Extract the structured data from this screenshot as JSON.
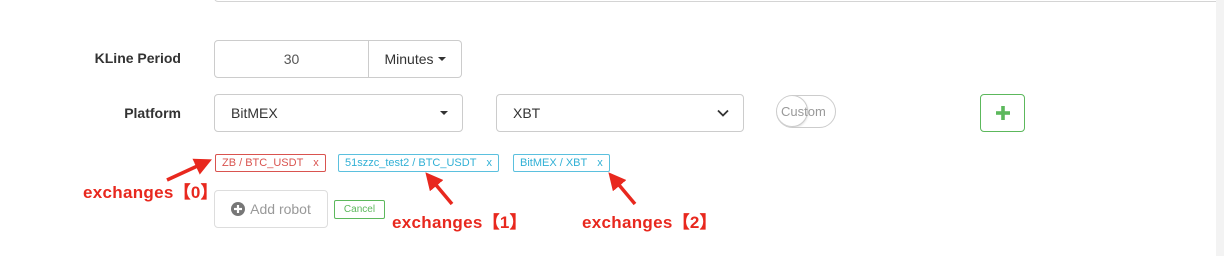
{
  "kline": {
    "label": "KLine Period",
    "value": "30",
    "unit": "Minutes"
  },
  "platform": {
    "label": "Platform",
    "exchange": "BitMEX",
    "symbol": "XBT",
    "custom_toggle": "Custom",
    "add_icon": "plus-icon"
  },
  "exchanges": [
    {
      "label": "ZB / BTC_USDT",
      "remove": "x",
      "color": "#d9534f"
    },
    {
      "label": "51szzc_test2 / BTC_USDT",
      "remove": "x",
      "color": "#5bc0de"
    },
    {
      "label": "BitMEX / XBT",
      "remove": "x",
      "color": "#5bc0de"
    }
  ],
  "actions": {
    "add_robot": "Add robot",
    "add_robot_icon": "plus-circle-icon",
    "cancel": "Cancel"
  },
  "annotations": [
    "exchanges【0】",
    "exchanges【1】",
    "exchanges【2】"
  ],
  "colors": {
    "annotation": "#e8281e",
    "success": "#5cb85c"
  }
}
